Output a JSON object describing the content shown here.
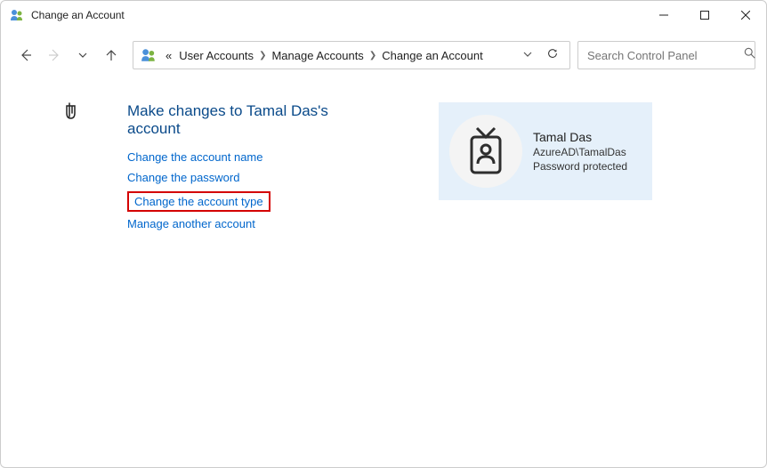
{
  "window": {
    "title": "Change an Account"
  },
  "breadcrumb": {
    "prefix": "«",
    "items": [
      "User Accounts",
      "Manage Accounts",
      "Change an Account"
    ]
  },
  "search": {
    "placeholder": "Search Control Panel"
  },
  "heading": "Make changes to Tamal Das's account",
  "links": {
    "change_name": "Change the account name",
    "change_password": "Change the password",
    "change_type": "Change the account type",
    "manage_another": "Manage another account"
  },
  "account": {
    "name": "Tamal Das",
    "domain": "AzureAD\\TamalDas",
    "status": "Password protected"
  }
}
